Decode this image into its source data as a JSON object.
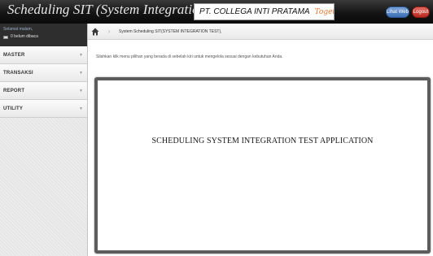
{
  "header": {
    "app_title": "Scheduling SIT (System Integration Test)",
    "company_name": "PT. COLLEGA INTI PRATAMA",
    "tagline": "Together, we make IT Better",
    "lihat_web_label": "Lihat Web",
    "logout_label": "Logout"
  },
  "sidebar": {
    "greeting": "Selamat malam,",
    "unread_messages": "0 belum dibaca",
    "menu": [
      {
        "label": "MASTER"
      },
      {
        "label": "TRANSAKSI"
      },
      {
        "label": "REPORT"
      },
      {
        "label": "UTILITY"
      }
    ]
  },
  "main": {
    "breadcrumb_text": "System Scheduling SIT(SYSTEM INTEGRATION TEST),",
    "info_text": "Silahkan klik menu pilihan yang berada di sebelah kiri untuk mengelola sesuai dengan kebutuhan Anda.",
    "content_title": "SCHEDULING SYSTEM INTEGRATION TEST APPLICATION"
  },
  "icons": {
    "home": "home-icon",
    "chevron": "chevron-down-icon",
    "mail": "mail-icon"
  }
}
